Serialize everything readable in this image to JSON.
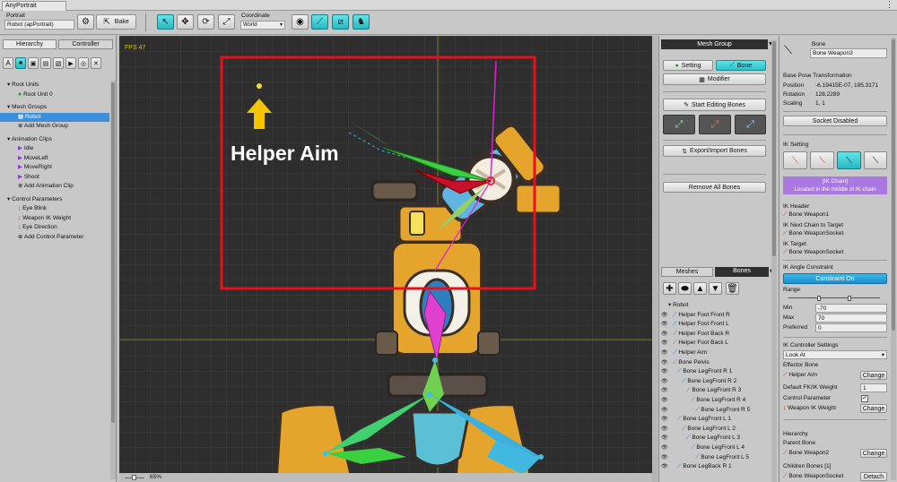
{
  "window": {
    "title": "AnyPortrait"
  },
  "toolbar": {
    "portrait_label": "Portrait",
    "portrait_value": "Robot (apPortrait)",
    "bake_label": "Bake",
    "coordinate_label": "Coordinate",
    "coordinate_value": "World"
  },
  "left": {
    "tabs": [
      "Hierarchy",
      "Controller"
    ],
    "root_units_header": "Root Units",
    "root_units": [
      "Root Unit 0"
    ],
    "mesh_groups_header": "Mesh Groups",
    "mesh_groups": [
      "Robot",
      "Add Mesh Group"
    ],
    "animation_header": "Animation Clips",
    "animation_clips": [
      "Idle",
      "MoveLeft",
      "MoveRight",
      "Shoot",
      "Add Animation Clip"
    ],
    "control_header": "Control Parameters",
    "control_params": [
      "Eye Blink",
      "Weapon IK Weight",
      "Eye Direction",
      "Add Control Parameter"
    ]
  },
  "viewport": {
    "fps": "FPS 47",
    "annotation": "Helper Aim",
    "zoom": "65%"
  },
  "mid": {
    "mesh_group_label": "Mesh Group",
    "setting_label": "Setting",
    "bone_label": "Bone",
    "modifier_label": "Modifier",
    "start_editing_label": "Start Editing Bones",
    "export_import_label": "Export/Import Bones",
    "remove_all_label": "Remove All Bones",
    "tabs": [
      "Meshes",
      "Bones"
    ],
    "tree": [
      {
        "label": "Robot",
        "depth": 0
      },
      {
        "label": "Helper Foot Front R",
        "depth": 1
      },
      {
        "label": "Helper Foot Front L",
        "depth": 1
      },
      {
        "label": "Helper Foot Back R",
        "depth": 1
      },
      {
        "label": "Helper Foot Back L",
        "depth": 1
      },
      {
        "label": "Helper Aim",
        "depth": 1
      },
      {
        "label": "Bone Pelvis",
        "depth": 1
      },
      {
        "label": "Bone LegFront R 1",
        "depth": 2
      },
      {
        "label": "Bone LegFront R 2",
        "depth": 3
      },
      {
        "label": "Bone LegFront R 3",
        "depth": 4
      },
      {
        "label": "Bone LegFront R 4",
        "depth": 5
      },
      {
        "label": "Bone LegFront R 5",
        "depth": 6
      },
      {
        "label": "Bone LegFront L 1",
        "depth": 2
      },
      {
        "label": "Bone LegFront L 2",
        "depth": 3
      },
      {
        "label": "Bone LegFront L 3",
        "depth": 4
      },
      {
        "label": "Bone LegFront L 4",
        "depth": 5
      },
      {
        "label": "Bone LegFront L 5",
        "depth": 6
      },
      {
        "label": "Bone LegBack R 1",
        "depth": 2
      }
    ]
  },
  "right": {
    "bone_header": "Bone",
    "bone_name": "Bone Weapon3",
    "base_pose_label": "Base Pose Transformation",
    "position_label": "Position",
    "position_value": "-6.19415E-07, 195.3171",
    "rotation_label": "Rotation",
    "rotation_value": "128.2289",
    "scaling_label": "Scaling",
    "scaling_value": "1, 1",
    "socket_label": "Socket Disabled",
    "ik_setting_label": "IK Setting",
    "ik_chain_title": "[IK Chain]",
    "ik_chain_desc": "Located in the middle of IK chain",
    "ik_header_label": "IK Header",
    "ik_header_value": "Bone Weapon1",
    "ik_next_label": "IK Next Chain to Target",
    "ik_next_value": "Bone WeaponSocket",
    "ik_target_label": "IK Target",
    "ik_target_value": "Bone WeaponSocket",
    "ik_angle_label": "IK Angle Constraint",
    "constraint_btn": "Constraint On",
    "range_label": "Range",
    "min_label": "Min",
    "min_value": "-70",
    "max_label": "Max",
    "max_value": "70",
    "preferred_label": "Preferred",
    "preferred_value": "0",
    "ik_controller_label": "IK Controller Settings",
    "look_at_value": "Look At",
    "effector_label": "Effector Bone",
    "effector_value": "Helper Aim",
    "change_label": "Change",
    "default_weight_label": "Default FK/IK Weight",
    "default_weight_value": "1",
    "control_param_label": "Control Parameter",
    "control_param_value": "Weapon IK Weight",
    "hierarchy_label": "Hierarchy",
    "parent_label": "Parent Bone",
    "parent_value": "Bone Weapon2",
    "children_label": "Children Bones [1]",
    "child_value": "Bone WeaponSocket",
    "detach_label": "Detach"
  },
  "colors": {
    "accent": "#2fc0c8",
    "selection": "#3d8fdc",
    "annotation": "#e8101a",
    "arrow": "#f5c400"
  }
}
